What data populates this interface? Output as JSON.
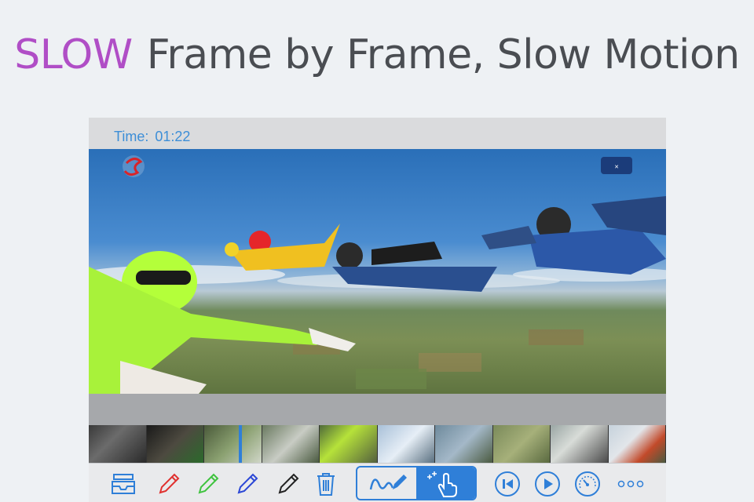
{
  "headline": {
    "accent": "SLOW",
    "rest": "Frame by Frame, Slow Motion"
  },
  "player": {
    "time_label": "Time:",
    "time_value": "01:22"
  },
  "toolbar": {
    "items": [
      {
        "name": "inbox-tray-icon",
        "color": "#2f7fd8"
      },
      {
        "name": "red-pencil-icon",
        "color": "#e0312f"
      },
      {
        "name": "green-pencil-icon",
        "color": "#3fc33f"
      },
      {
        "name": "blue-pencil-icon",
        "color": "#2b47d6"
      },
      {
        "name": "black-pencil-icon",
        "color": "#222222"
      },
      {
        "name": "trash-icon",
        "color": "#2f7fd8"
      },
      {
        "name": "draw-mode-icon",
        "color": "#2f7fd8"
      },
      {
        "name": "touch-move-icon",
        "color": "#ffffff"
      },
      {
        "name": "previous-frame-icon",
        "color": "#2f7fd8"
      },
      {
        "name": "play-icon",
        "color": "#2f7fd8"
      },
      {
        "name": "speed-gauge-icon",
        "color": "#2f7fd8"
      },
      {
        "name": "more-icon",
        "color": "#2f7fd8"
      }
    ],
    "selected_mode": "touch-move"
  },
  "colors": {
    "accent": "#b04ec6",
    "primary": "#2f7fd8"
  }
}
